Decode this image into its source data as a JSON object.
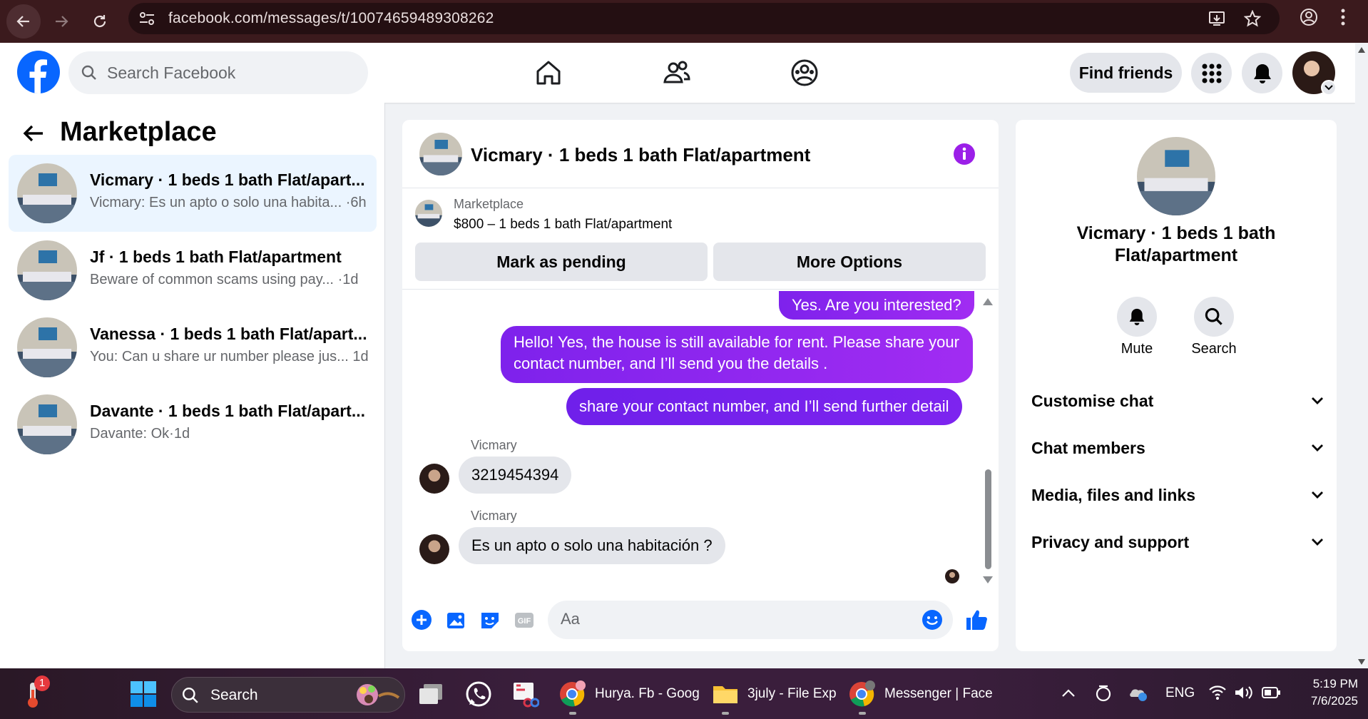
{
  "browser": {
    "url": "facebook.com/messages/t/10074659489308262"
  },
  "header": {
    "search_placeholder": "Search Facebook",
    "find_friends": "Find friends"
  },
  "sidebar": {
    "title": "Marketplace",
    "chats": [
      {
        "title": "Vicmary · 1 beds 1 bath Flat/apart...",
        "preview": "Vicmary: Es un apto o solo una habita...",
        "time": "·6h"
      },
      {
        "title": "Jf · 1 beds 1 bath Flat/apartment",
        "preview": "Beware of common scams using pay...",
        "time": "·1d"
      },
      {
        "title": "Vanessa · 1 beds 1 bath Flat/apart...",
        "preview": "You: Can u share ur number please jus...",
        "time": "1d"
      },
      {
        "title": "Davante · 1 beds 1 bath Flat/apart...",
        "preview": "Davante: Ok",
        "time": "·1d"
      }
    ]
  },
  "chat": {
    "title": "Vicmary · 1 beds 1 bath Flat/apartment",
    "listing_label": "Marketplace",
    "listing_text": "$800 – 1 beds 1 bath Flat/apartment",
    "mark_pending": "Mark as pending",
    "more_options": "More Options",
    "messages": [
      {
        "from": "me",
        "text": "Yes. Are you interested?"
      },
      {
        "from": "me",
        "line1": "Hello! Yes, the house is still available for rent. Please share your",
        "line2": "contact number, and I’ll send you the details ."
      },
      {
        "from": "me",
        "text": "share your contact number, and I’ll send further detail"
      },
      {
        "from": "them",
        "sender": "Vicmary",
        "text": "3219454394"
      },
      {
        "from": "them",
        "sender": "Vicmary",
        "text": "Es un apto o solo una habitación ?"
      }
    ],
    "composer_placeholder": "Aa"
  },
  "info_panel": {
    "name_line1": "Vicmary · 1 beds 1 bath",
    "name_line2": "Flat/apartment",
    "mute": "Mute",
    "search": "Search",
    "sections": [
      "Customise chat",
      "Chat members",
      "Media, files and links",
      "Privacy and support"
    ]
  },
  "taskbar": {
    "search": "Search",
    "notif_count": "1",
    "apps": [
      {
        "label": "Hurya. Fb - Goog"
      },
      {
        "label": "3july - File Exp"
      },
      {
        "label": "Messenger | Face"
      }
    ],
    "lang": "ENG",
    "time": "5:19 PM",
    "date": "7/6/2025"
  },
  "colors": {
    "facebook_blue": "#0866ff",
    "messenger_purple": "#8a2be2",
    "browser_bar": "#3b1a1d"
  }
}
